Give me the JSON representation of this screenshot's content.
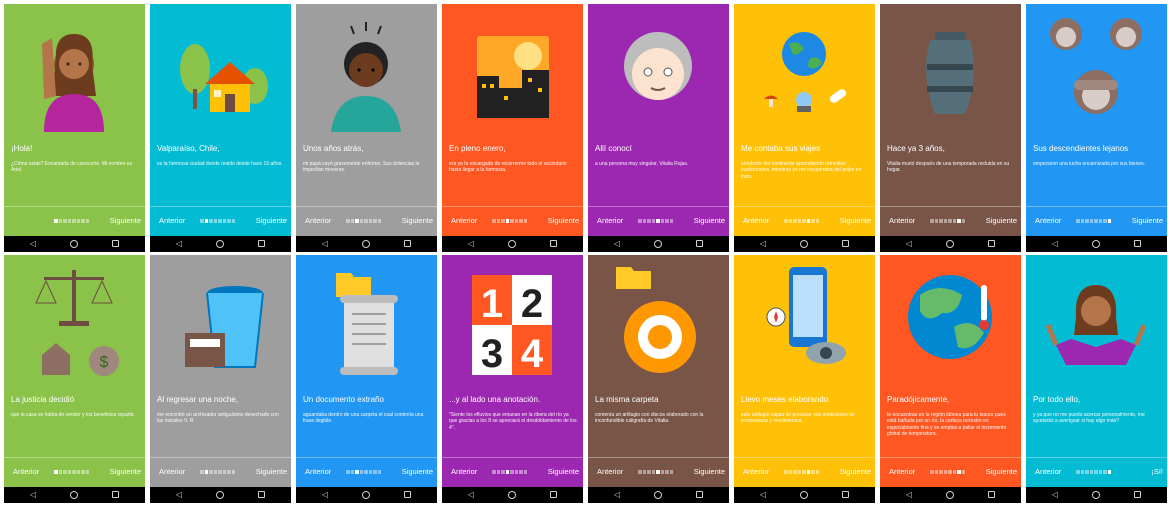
{
  "screens": [
    {
      "bg": "#8bc34a",
      "icon": "woman-waving-icon",
      "title": "¡Hola!",
      "body": "¿Cómo estás? Encantada de conocerte. Mi nombre es Ariel.",
      "prev": "",
      "next": "Siguiente",
      "step": 1
    },
    {
      "bg": "#03bcd4",
      "icon": "house-trees-icon",
      "title": "Valparaíso, Chile,",
      "body": "es la hermosa ciudad donde resido desde hace 19 años.",
      "prev": "Anterior",
      "next": "Siguiente",
      "step": 2
    },
    {
      "bg": "#9e9e9e",
      "icon": "sick-child-icon",
      "title": "Unos años atrás,",
      "body": "mi papá cayó gravemente enfermo. Sus dolencias le impedían moverse.",
      "prev": "Anterior",
      "next": "Siguiente",
      "step": 3
    },
    {
      "bg": "#ff5722",
      "icon": "city-sun-icon",
      "title": "En pleno enero,",
      "body": "era yo la encargada de recorrerme todo el vecindario hasta llegar a la farmacia.",
      "prev": "Anterior",
      "next": "Siguiente",
      "step": 4
    },
    {
      "bg": "#9c27b0",
      "icon": "old-woman-icon",
      "title": "Allí conocí",
      "body": "a una persona muy singular, Vitalia Rojas.",
      "prev": "Anterior",
      "next": "Siguiente",
      "step": 5
    },
    {
      "bg": "#ffc107",
      "icon": "globe-remedies-icon",
      "title": "Me contaba sus viajes",
      "body": "alrededor del continente aprendiendo remedios tradicionales, mientras yo me recuperaba del golpe en todo.",
      "prev": "Anterior",
      "next": "Siguiente",
      "step": 6
    },
    {
      "bg": "#795548",
      "icon": "urn-icon",
      "title": "Hace ya 3 años,",
      "body": "Vitalia murió después de una temporada recluida en su hogar.",
      "prev": "Anterior",
      "next": "Siguiente",
      "step": 7
    },
    {
      "bg": "#2196f3",
      "icon": "monkeys-icon",
      "title": "Sus descendientes lejanos",
      "body": "empezaron una lucha encarnizada por sus bienes.",
      "prev": "Anterior",
      "next": "Siguiente",
      "step": 8
    },
    {
      "bg": "#8bc34a",
      "icon": "scales-house-money-icon",
      "title": "La justicia decidió",
      "body": "que la casa se había de vender y los beneficios repartir.",
      "prev": "Anterior",
      "next": "Siguiente",
      "step": 1
    },
    {
      "bg": "#9e9e9e",
      "icon": "wastebasket-files-icon",
      "title": "Al regresar una noche,",
      "body": "me encontré un archivador antiguísimo desechado con las iniciales V. R.",
      "prev": "Anterior",
      "next": "Siguiente",
      "step": 2
    },
    {
      "bg": "#2196f3",
      "icon": "scroll-folder-icon",
      "title": "Un documento extraño",
      "body": "aguardaba dentro de una carpeta el cual contenía una frase ilegible.",
      "prev": "Anterior",
      "next": "Siguiente",
      "step": 3
    },
    {
      "bg": "#9c27b0",
      "icon": "numbers-1234-icon",
      "title": "...y al lado una anotación.",
      "body": "\"Siente los efluvios que emanan en la ribera del río ya que gracias a los 8 se apreciará el desdoblamiento de los 4\".",
      "prev": "Anterior",
      "next": "Siguiente",
      "step": 4
    },
    {
      "bg": "#795548",
      "icon": "folder-disc-icon",
      "title": "La misma carpeta",
      "body": "contenía un artilugio con discos elaborado con la inconfundible caligrafía de Vitalia.",
      "prev": "Anterior",
      "next": "Siguiente",
      "step": 5
    },
    {
      "bg": "#ffc107",
      "icon": "phone-compass-eye-icon",
      "title": "Llevo meses elaborando",
      "body": "este artilugio capaz de procesar mis mediciones de temperatura y movimientos.",
      "prev": "Anterior",
      "next": "Siguiente",
      "step": 6
    },
    {
      "bg": "#ff5722",
      "icon": "earth-thermometer-icon",
      "title": "Paradójicamente,",
      "body": "te encuentras en la región idónea para tu tesoro pues está bañada por un río, la corteza terrestre es especialmente fina y se emplea a paliar el incremento global de temperatura.",
      "prev": "Anterior",
      "next": "Siguiente",
      "step": 7
    },
    {
      "bg": "#03bcd4",
      "icon": "woman-shrugging-icon",
      "title": "Por todo ello,",
      "body": "y ya que no me puedo acercar personalmente, me ayudarás a averiguar si hay algo más?",
      "prev": "Anterior",
      "next": "¡Sí!",
      "step": 8
    }
  ],
  "system_bar": {
    "back": "◁",
    "home": "○",
    "recent": "□"
  }
}
